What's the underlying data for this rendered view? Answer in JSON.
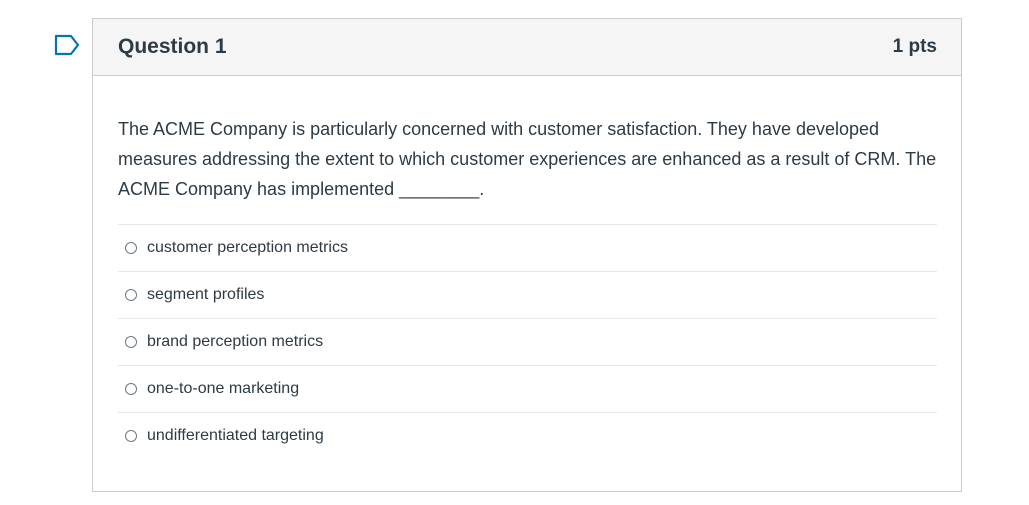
{
  "flag": {
    "icon": "flag-bookmark-icon",
    "color": "#0374b5"
  },
  "question": {
    "title": "Question 1",
    "points": "1 pts",
    "text": "The ACME Company is particularly concerned with customer satisfaction. They have developed measures addressing the extent to which customer experiences are enhanced as a result of CRM. The ACME Company has implemented ________.",
    "answers": [
      {
        "label": "customer perception metrics",
        "selected": false
      },
      {
        "label": "segment profiles",
        "selected": false
      },
      {
        "label": "brand perception metrics",
        "selected": false
      },
      {
        "label": "one-to-one marketing",
        "selected": false
      },
      {
        "label": "undifferentiated targeting",
        "selected": false
      }
    ]
  }
}
